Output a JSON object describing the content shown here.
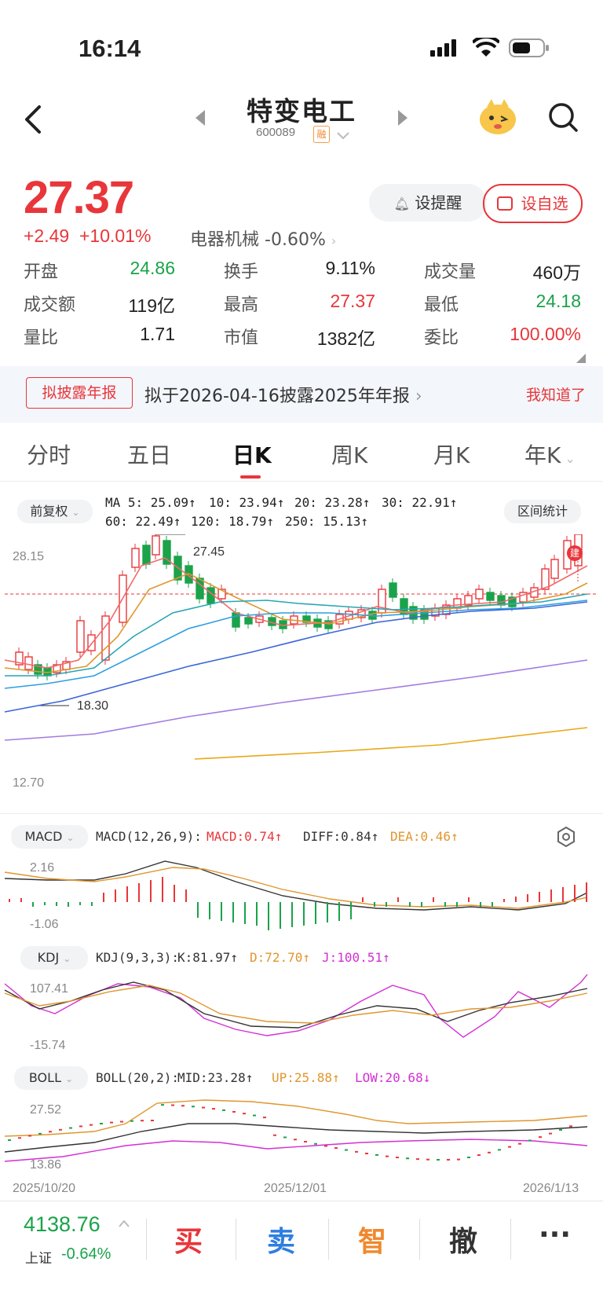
{
  "status": {
    "time": "16:14"
  },
  "header": {
    "title": "特变电工",
    "code": "600089",
    "margin_badge": "融"
  },
  "quote": {
    "price": "27.37",
    "change": "+2.49",
    "change_pct": "+10.01%",
    "sector": "电器机械",
    "sector_pct": "-0.60%",
    "remind_label": "设提醒",
    "watch_label": "设自选",
    "stats": [
      {
        "k": "开盘",
        "v": "24.86",
        "color": "#1aa34a"
      },
      {
        "k": "换手",
        "v": "9.11%",
        "color": "#222222"
      },
      {
        "k": "成交量",
        "v": "460万",
        "color": "#222222"
      },
      {
        "k": "成交额",
        "v": "119亿",
        "color": "#222222"
      },
      {
        "k": "最高",
        "v": "27.37",
        "color": "#e8363a"
      },
      {
        "k": "最低",
        "v": "24.18",
        "color": "#1aa34a"
      },
      {
        "k": "量比",
        "v": "1.71",
        "color": "#222222"
      },
      {
        "k": "市值",
        "v": "1382亿",
        "color": "#222222"
      },
      {
        "k": "委比",
        "v": "100.00%",
        "color": "#e8363a"
      }
    ]
  },
  "notice": {
    "tag": "拟披露年报",
    "text": "拟于2026-04-16披露2025年年报",
    "dismiss": "我知道了"
  },
  "tabs": [
    "分时",
    "五日",
    "日K",
    "周K",
    "月K",
    "年K"
  ],
  "kline": {
    "adjust": "前复权",
    "range_stats": "区间统计",
    "ma": [
      {
        "label": "MA 5: 25.09↑",
        "color": "#f06a6a"
      },
      {
        "label": "10: 23.94↑",
        "color": "#e0962e"
      },
      {
        "label": "20: 23.28↑",
        "color": "#27a6b4"
      },
      {
        "label": "30: 22.91↑",
        "color": "#2f9ee0"
      },
      {
        "label": "60: 22.49↑",
        "color": "#3a66d8"
      },
      {
        "label": "120: 18.79↑",
        "color": "#a27be0"
      },
      {
        "label": "250: 15.13↑",
        "color": "#e8a817"
      }
    ],
    "y_top": "28.15",
    "y_bottom": "12.70",
    "high_mark": "27.45",
    "low_mark": "18.30",
    "build_badge": "建",
    "macd": {
      "name": "MACD",
      "params": "MACD(12,26,9):",
      "macd": "MACD:0.74↑",
      "diff": "DIFF:0.84↑",
      "dea": "DEA:0.46↑",
      "y_top": "2.16",
      "y_bottom": "-1.06"
    },
    "kdj": {
      "name": "KDJ",
      "params": "KDJ(9,3,3):",
      "k": "K:81.97↑",
      "d": "D:72.70↑",
      "j": "J:100.51↑",
      "y_top": "107.41",
      "y_bottom": "-15.74"
    },
    "boll": {
      "name": "BOLL",
      "params": "BOLL(20,2):",
      "mid": "MID:23.28↑",
      "up": "UP:25.88↑",
      "low": "LOW:20.68↓",
      "y_top": "27.52",
      "y_bottom": "13.86"
    },
    "dates": [
      "2025/10/20",
      "2025/12/01",
      "2026/1/13"
    ]
  },
  "bottom": {
    "index_value": "4138.76",
    "index_name": "上证",
    "index_pct": "-0.64%",
    "buy": "买",
    "sell": "卖",
    "smart": "智",
    "cancel": "撤",
    "more": "···"
  }
}
